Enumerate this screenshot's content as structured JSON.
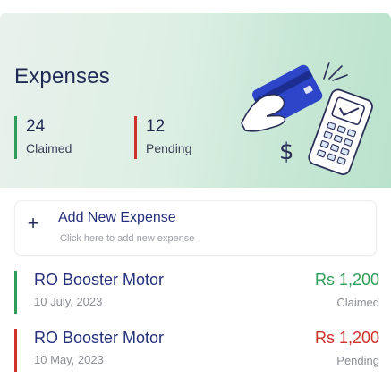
{
  "header": {
    "title": "Expenses"
  },
  "stats": {
    "claimed": {
      "value": "24",
      "label": "Claimed"
    },
    "pending": {
      "value": "12",
      "label": "Pending"
    }
  },
  "add_expense": {
    "title": "Add New Expense",
    "subtitle": "Click here to add new expense",
    "icon": "plus-icon"
  },
  "expenses": [
    {
      "title": "RO Booster Motor",
      "date": "10 July, 2023",
      "amount": "Rs 1,200",
      "status": "Claimed"
    },
    {
      "title": "RO Booster Motor",
      "date": "10 May, 2023",
      "amount": "Rs 1,200",
      "status": "Pending"
    }
  ],
  "colors": {
    "claimed": "#2e9d57",
    "pending": "#d0312d",
    "heading": "#1f2a55",
    "title": "#24307a"
  },
  "illustration": {
    "icon": "card-payment-icon"
  }
}
